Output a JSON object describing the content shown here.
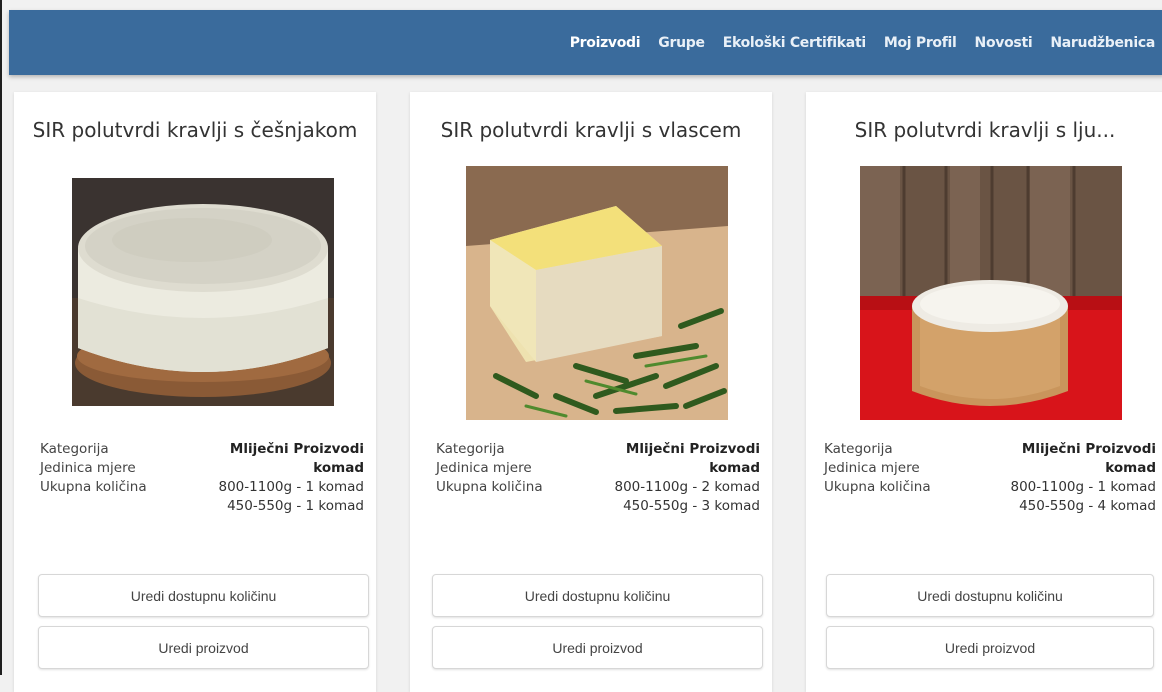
{
  "nav": {
    "items": [
      {
        "label": "Proizvodi"
      },
      {
        "label": "Grupe"
      },
      {
        "label": "Ekološki Certifikati"
      },
      {
        "label": "Moj Profil"
      },
      {
        "label": "Novosti"
      },
      {
        "label": "Narudžbenica"
      }
    ],
    "active": "Proizvodi"
  },
  "colors": {
    "header_bg": "#3a6b9c",
    "page_bg": "#f1f1f1",
    "card_bg": "#ffffff"
  },
  "labels": {
    "category": "Kategorija",
    "unit": "Jedinica mjere",
    "quantity": "Ukupna količina"
  },
  "products": [
    {
      "title": "SIR polutvrdi kravlji s češnjakom",
      "image": "cheese-wheel-garlic-image",
      "category": "Mliječni Proizvodi",
      "unit": "komad",
      "quantities": [
        "800-1100g - 1 komad",
        "450-550g - 1 komad"
      ],
      "edit_quantity_label": "Uredi dostupnu količinu",
      "edit_product_label": "Uredi proizvod"
    },
    {
      "title": "SIR polutvrdi kravlji s vlascem",
      "image": "cheese-chives-image",
      "category": "Mliječni Proizvodi",
      "unit": "komad",
      "quantities": [
        "800-1100g - 2 komad",
        "450-550g - 3 komad"
      ],
      "edit_quantity_label": "Uredi dostupnu količinu",
      "edit_product_label": "Uredi proizvod"
    },
    {
      "title": "SIR polutvrdi kravlji s lju...",
      "image": "cheese-red-background-image",
      "category": "Mliječni Proizvodi",
      "unit": "komad",
      "quantities": [
        "800-1100g - 1 komad",
        "450-550g - 4 komad"
      ],
      "edit_quantity_label": "Uredi dostupnu količinu",
      "edit_product_label": "Uredi proizvod"
    }
  ]
}
